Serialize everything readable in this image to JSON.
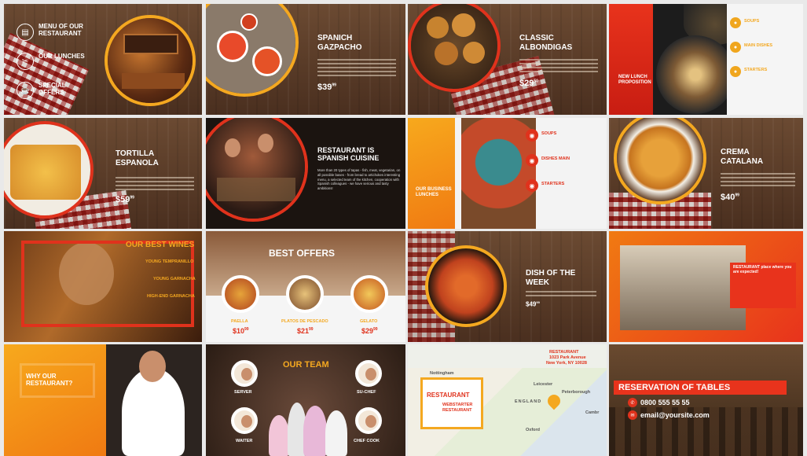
{
  "slides": {
    "s1": {
      "menu": "MENU OF OUR RESTAURANT",
      "lunches": "OUR LUNCHES",
      "offers": "SPECIAL OFFERS"
    },
    "s2": {
      "title": "SPANICH GAZPACHO",
      "price": "$39",
      "cents": "99"
    },
    "s3": {
      "title": "CLASSIC ALBONDIGAS",
      "price": "$29",
      "cents": "50"
    },
    "s4": {
      "title": "NEW LUNCH PROPOSITION",
      "item1": "SOUPS",
      "item2": "MAIN DISHES",
      "item3": "STARTERS"
    },
    "s5": {
      "title": "TORTILLA ESPANOLA",
      "price": "$59",
      "cents": "99"
    },
    "s6": {
      "title": "RESTAURANT IS SPANISH CUISINE",
      "body": "More than 20 types of tapas - fish, meat, vegetarian, on all possible bases - from bread to artichokes interesting menu, a selected team of the kitchen, cooperation with Spanish colleagues - we have serious and tasty ambitions!"
    },
    "s7": {
      "title": "OUR BUSINESS LUNCHES",
      "item1": "SOUPS",
      "item2": "DISHES MAIN",
      "item3": "STARTERS"
    },
    "s8": {
      "title": "CREMA CATALANA",
      "price": "$40",
      "cents": "99"
    },
    "s9": {
      "title": "OUR BEST WINES",
      "w1": "YOUNG TEMPRANILLO",
      "w2": "YOUNG GARNACHA",
      "w3": "HIGH-END GARNACHA"
    },
    "s10": {
      "title": "BEST OFFERS",
      "n1": "PAELLA",
      "p1": "$10",
      "c1": "99",
      "n2": "PLATOS DE PESCADO",
      "p2": "$21",
      "c2": "99",
      "n3": "GELATO",
      "p3": "$29",
      "c3": "99"
    },
    "s11": {
      "title": "DISH OF THE WEEK",
      "price": "$49",
      "cents": "99"
    },
    "s12": {
      "title": "RESTAURANT place where you are expected!"
    },
    "s13": {
      "title": "WHY OUR RESTAURANT?"
    },
    "s14": {
      "title": "OUR TEAM",
      "r1": "SERVER",
      "r2": "SU-CHEF",
      "r3": "WAITER",
      "r4": "CHEF COOK"
    },
    "s15": {
      "title": "RESTAURANT",
      "sub": "WEBSTARTER",
      "sub2": "RESTAURANT",
      "addr1": "Restaurant",
      "addr2": "1023 Park Avenue",
      "addr3": "New York, NY 10028",
      "map1": "ENGLAND",
      "map2": "Peterborough",
      "map3": "Leicester",
      "map4": "Cambr",
      "map5": "Oxford",
      "map6": "Nottingham"
    },
    "s16": {
      "title": "RESERVATION OF TABLES",
      "phone": "0800 555 55 55",
      "email": "email@yoursite.com"
    }
  },
  "colors": {
    "accent": "#f4a820",
    "red": "#e0321c",
    "orange": "#f07a12"
  }
}
